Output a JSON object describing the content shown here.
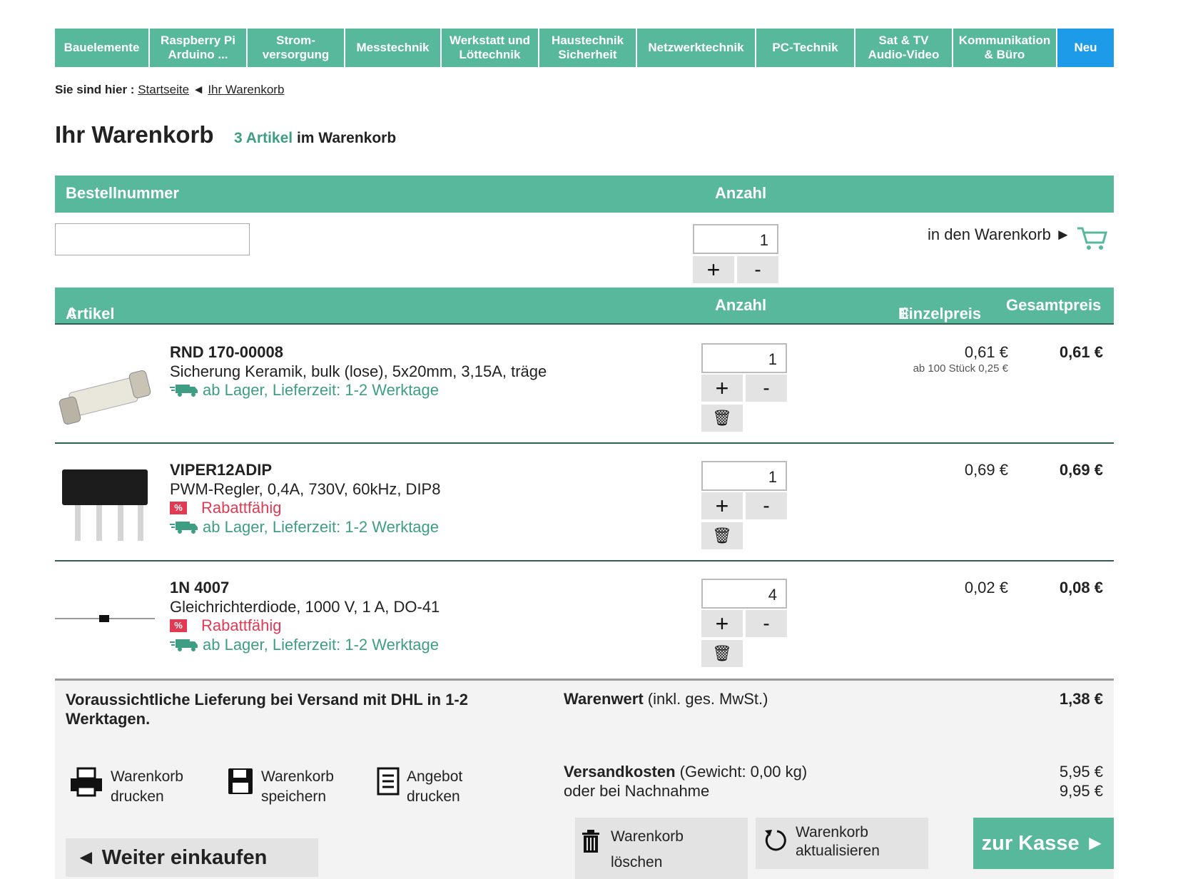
{
  "nav": [
    {
      "label": "Bauelemente"
    },
    {
      "label": "Raspberry Pi\nArduino ..."
    },
    {
      "label": "Strom-\nversorgung"
    },
    {
      "label": "Messtechnik"
    },
    {
      "label": "Werkstatt und\nLöttechnik"
    },
    {
      "label": "Haustechnik\nSicherheit"
    },
    {
      "label": "Netzwerktechnik"
    },
    {
      "label": "PC-Technik"
    },
    {
      "label": "Sat & TV\nAudio-Video"
    },
    {
      "label": "Kommunikation\n& Büro"
    },
    {
      "label": "Neu"
    }
  ],
  "breadcrumb": {
    "prefix": "Sie sind hier :",
    "home": "Startseite",
    "current": "Ihr Warenkorb"
  },
  "page": {
    "title": "Ihr Warenkorb",
    "count": "3 Artikel",
    "count_suffix": "im Warenkorb"
  },
  "quick_add": {
    "header_left": "Bestellnummer",
    "header_qty": "Anzahl",
    "qty_value": "1",
    "add_label": "in den Warenkorb ►"
  },
  "table": {
    "col_article": "Artikel",
    "col_qty": "Anzahl",
    "col_unit": "Einzelpreis",
    "col_total": "Gesamtpreis"
  },
  "items": [
    {
      "sku": "RND 170-00008",
      "desc": "Sicherung Keramik, bulk (lose), 5x20mm, 3,15A, träge",
      "rabatt": "",
      "stock": "ab Lager,  Lieferzeit: 1-2 Werktage",
      "qty": "1",
      "unit": "0,61 €",
      "tier": "ab 100 Stück 0,25 €",
      "total": "0,61 €"
    },
    {
      "sku": "VIPER12ADIP",
      "desc": "PWM-Regler, 0,4A, 730V, 60kHz, DIP8",
      "rabatt": "Rabattfähig",
      "stock": "ab Lager,  Lieferzeit: 1-2 Werktage",
      "qty": "1",
      "unit": "0,69 €",
      "tier": "",
      "total": "0,69 €"
    },
    {
      "sku": "1N 4007",
      "desc": "Gleichrichterdiode, 1000 V, 1 A, DO-41",
      "rabatt": "Rabattfähig",
      "stock": "ab Lager,  Lieferzeit: 1-2 Werktage",
      "qty": "4",
      "unit": "0,02 €",
      "tier": "",
      "total": "0,08 €"
    }
  ],
  "pct_badge": "%",
  "footer": {
    "delivery_1": "Voraussichtliche Lieferung bei Versand mit DHL in 1-2",
    "delivery_2": "Werktagen.",
    "warenwert_label": "Warenwert",
    "warenwert_note": "(inkl. ges. MwSt.)",
    "warenwert_value": "1,38 €",
    "versand_label": "Versandkosten",
    "versand_note": "(Gewicht: 0,00 kg)",
    "versand_value": "5,95 €",
    "nachnahme_label": "oder bei Nachnahme",
    "nachnahme_value": "9,95 €",
    "print_1": "Warenkorb",
    "print_2": "drucken",
    "save_1": "Warenkorb",
    "save_2": "speichern",
    "offer_1": "Angebot",
    "offer_2": "drucken",
    "delete_1": "Warenkorb",
    "delete_2": "löschen",
    "update_1": "Warenkorb",
    "update_2": "aktualisieren",
    "continue": "◄ Weiter einkaufen",
    "checkout": "zur Kasse ►"
  },
  "colors": {
    "accent": "#58b89b",
    "new": "#1e9be8",
    "rabatt": "#e23a52",
    "green_text": "#3e9e83"
  }
}
